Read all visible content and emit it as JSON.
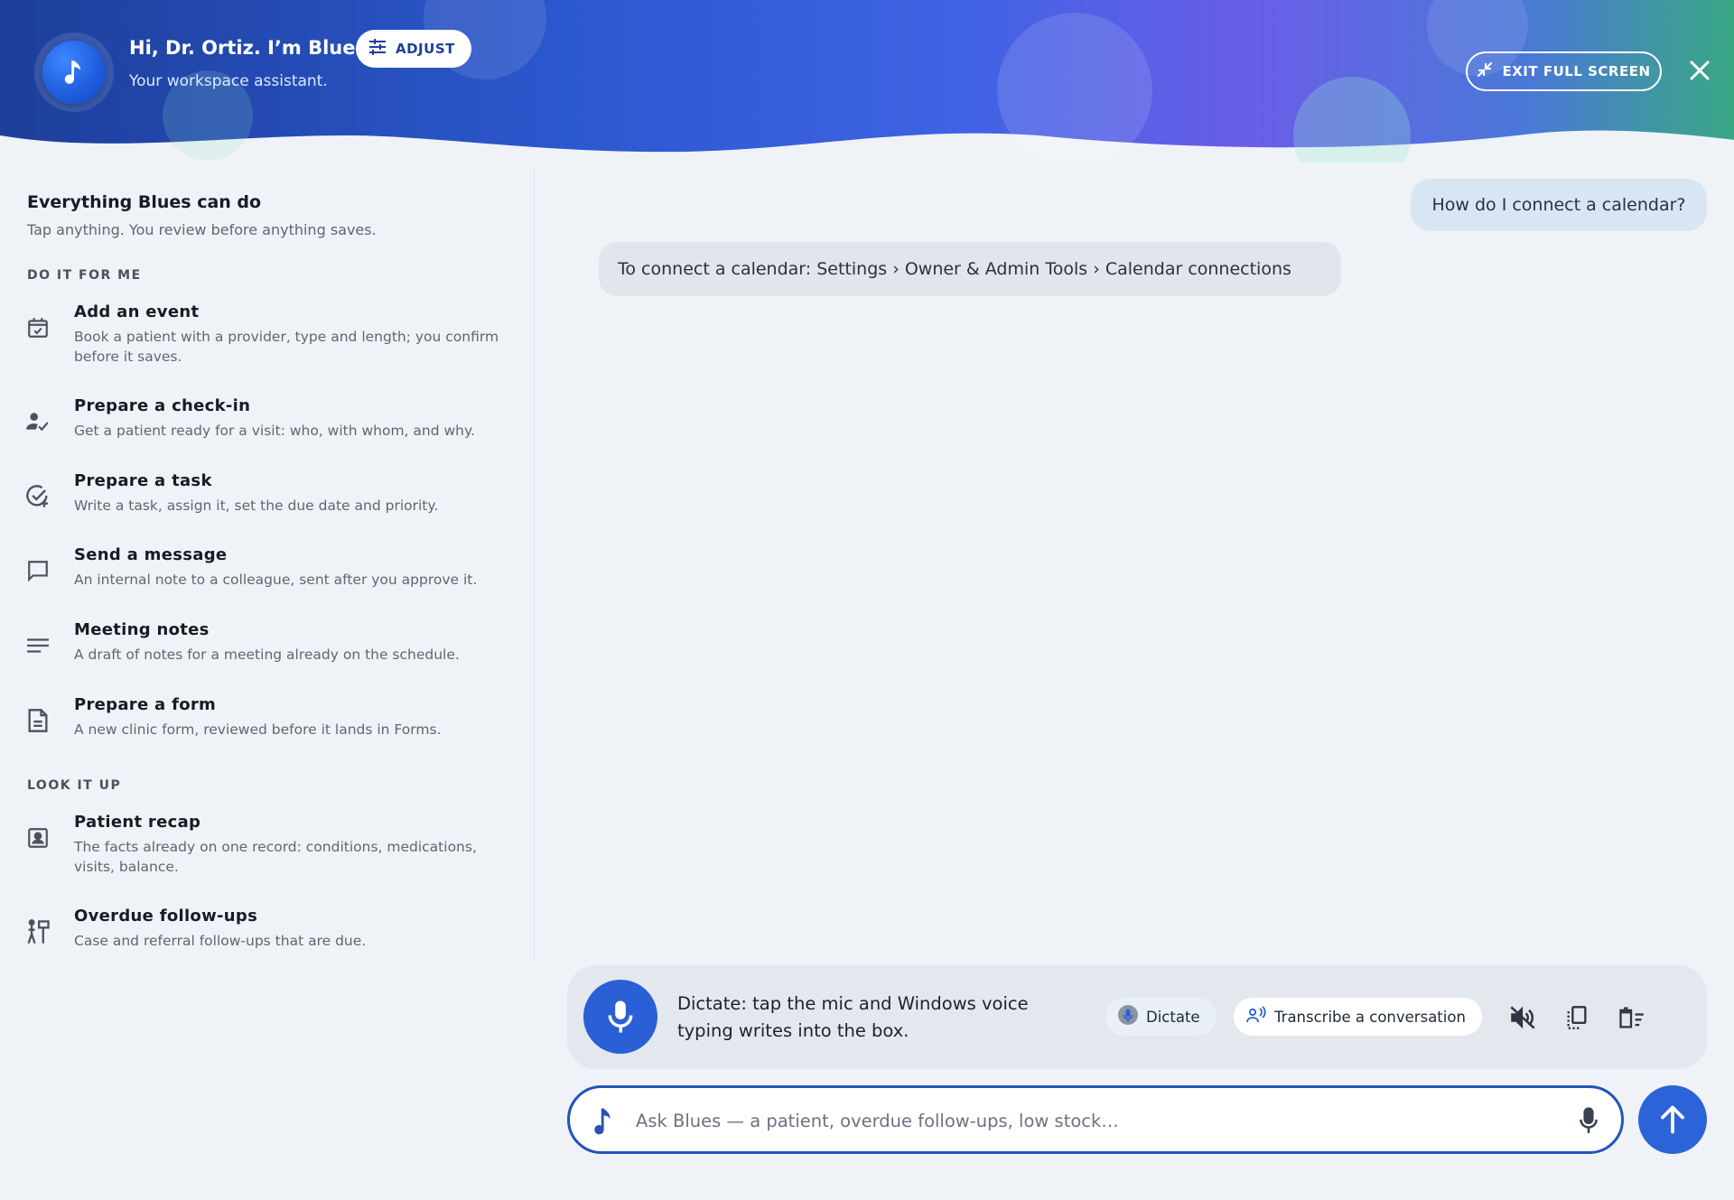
{
  "header": {
    "greeting": "Hi, Dr. Ortiz. I’m Blues.",
    "subtitle": "Your workspace assistant.",
    "adjust_label": "ADJUST",
    "exit_label": "EXIT FULL SCREEN",
    "avatar_icon": "music-note-icon",
    "colors": {
      "gradient_start": "#1d3f9a",
      "gradient_mid": "#3a63e0",
      "gradient_violet": "#6a5ee8",
      "gradient_end": "#3aa884"
    }
  },
  "left_panel": {
    "title": "Everything Blues can do",
    "subtitle": "Tap anything. You review before anything saves.",
    "sections": [
      {
        "label": "DO IT FOR ME",
        "items": [
          {
            "icon": "calendar-check-icon",
            "title": "Add an event",
            "desc": "Book a patient with a provider, type and length; you confirm before it saves."
          },
          {
            "icon": "person-check-icon",
            "title": "Prepare a check-in",
            "desc": "Get a patient ready for a visit: who, with whom, and why."
          },
          {
            "icon": "task-add-icon",
            "title": "Prepare a task",
            "desc": "Write a task, assign it, set the due date and priority."
          },
          {
            "icon": "chat-bubble-icon",
            "title": "Send a message",
            "desc": "An internal note to a colleague, sent after you approve it."
          },
          {
            "icon": "notes-lines-icon",
            "title": "Meeting notes",
            "desc": "A draft of notes for a meeting already on the schedule."
          },
          {
            "icon": "document-icon",
            "title": "Prepare a form",
            "desc": "A new clinic form, reviewed before it lands in Forms."
          }
        ]
      },
      {
        "label": "LOOK IT UP",
        "items": [
          {
            "icon": "patient-card-icon",
            "title": "Patient recap",
            "desc": "The facts already on one record: conditions, medications, visits, balance."
          },
          {
            "icon": "follow-up-signpost-icon",
            "title": "Overdue follow-ups",
            "desc": "Case and referral follow-ups that are due."
          }
        ]
      }
    ]
  },
  "chat": {
    "user_message": "How do I connect a calendar?",
    "bot_message": "To connect a calendar: Settings › Owner & Admin Tools › Calendar connections"
  },
  "dictate_bar": {
    "text": "Dictate: tap the mic and Windows voice typing writes into the box.",
    "dictate_chip": "Dictate",
    "transcribe_chip": "Transcribe a conversation",
    "tools": [
      "speaker-mute-icon",
      "copy-icon",
      "clear-list-icon"
    ]
  },
  "input": {
    "placeholder": "Ask Blues — a patient, overdue follow-ups, low stock…",
    "value": ""
  }
}
